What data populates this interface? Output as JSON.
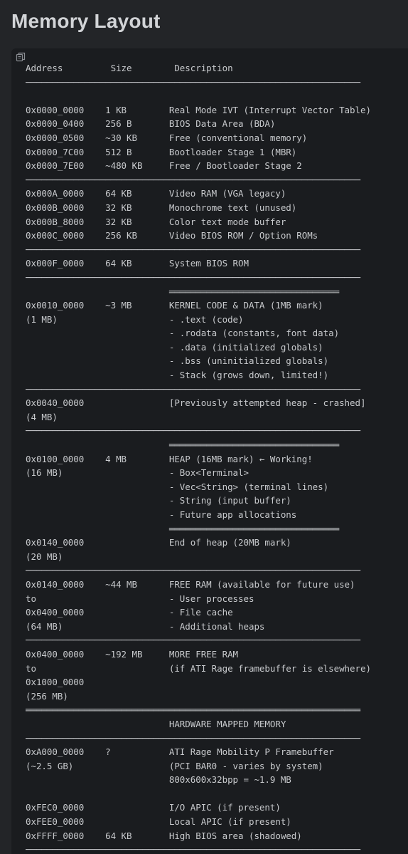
{
  "title": "Memory Layout",
  "copy_icon": "copy-icon",
  "code_lines": [
    "Address         Size        Description",
    "───────────────────────────────────────────────────────────────",
    "",
    "0x0000_0000    1 KB        Real Mode IVT (Interrupt Vector Table)",
    "0x0000_0400    256 B       BIOS Data Area (BDA)",
    "0x0000_0500    ~30 KB      Free (conventional memory)",
    "0x0000_7C00    512 B       Bootloader Stage 1 (MBR)",
    "0x0000_7E00    ~480 KB     Free / Bootloader Stage 2",
    "───────────────────────────────────────────────────────────────",
    "0x000A_0000    64 KB       Video RAM (VGA legacy)",
    "0x000B_0000    32 KB       Monochrome text (unused)",
    "0x000B_8000    32 KB       Color text mode buffer",
    "0x000C_0000    256 KB      Video BIOS ROM / Option ROMs",
    "───────────────────────────────────────────────────────────────",
    "0x000F_0000    64 KB       System BIOS ROM",
    "───────────────────────────────────────────────────────────────",
    "                           ════════════════════════════════",
    "0x0010_0000    ~3 MB       KERNEL CODE & DATA (1MB mark)",
    "(1 MB)                     - .text (code)",
    "                           - .rodata (constants, font data)",
    "                           - .data (initialized globals)",
    "                           - .bss (uninitialized globals)",
    "                           - Stack (grows down, limited!)",
    "───────────────────────────────────────────────────────────────",
    "0x0040_0000                [Previously attempted heap - crashed]",
    "(4 MB)",
    "───────────────────────────────────────────────────────────────",
    "                           ════════════════════════════════",
    "0x0100_0000    4 MB        HEAP (16MB mark) ← Working!",
    "(16 MB)                    - Box<Terminal>",
    "                           - Vec<String> (terminal lines)",
    "                           - String (input buffer)",
    "                           - Future app allocations",
    "                           ════════════════════════════════",
    "0x0140_0000                End of heap (20MB mark)",
    "(20 MB)",
    "───────────────────────────────────────────────────────────────",
    "0x0140_0000    ~44 MB      FREE RAM (available for future use)",
    "to                         - User processes",
    "0x0400_0000                - File cache",
    "(64 MB)                    - Additional heaps",
    "───────────────────────────────────────────────────────────────",
    "0x0400_0000    ~192 MB     MORE FREE RAM",
    "to                         (if ATI Rage framebuffer is elsewhere)",
    "0x1000_0000",
    "(256 MB)",
    "═══════════════════════════════════════════════════════════════",
    "                           HARDWARE MAPPED MEMORY",
    "───────────────────────────────────────────────────────────────",
    "0xA000_0000    ?           ATI Rage Mobility P Framebuffer",
    "(~2.5 GB)                  (PCI BAR0 - varies by system)",
    "                           800x600x32bpp = ~1.9 MB",
    "",
    "0xFEC0_0000                I/O APIC (if present)",
    "0xFEE0_0000                Local APIC (if present)",
    "0xFFFF_0000    64 KB       High BIOS area (shadowed)",
    "───────────────────────────────────────────────────────────────"
  ]
}
